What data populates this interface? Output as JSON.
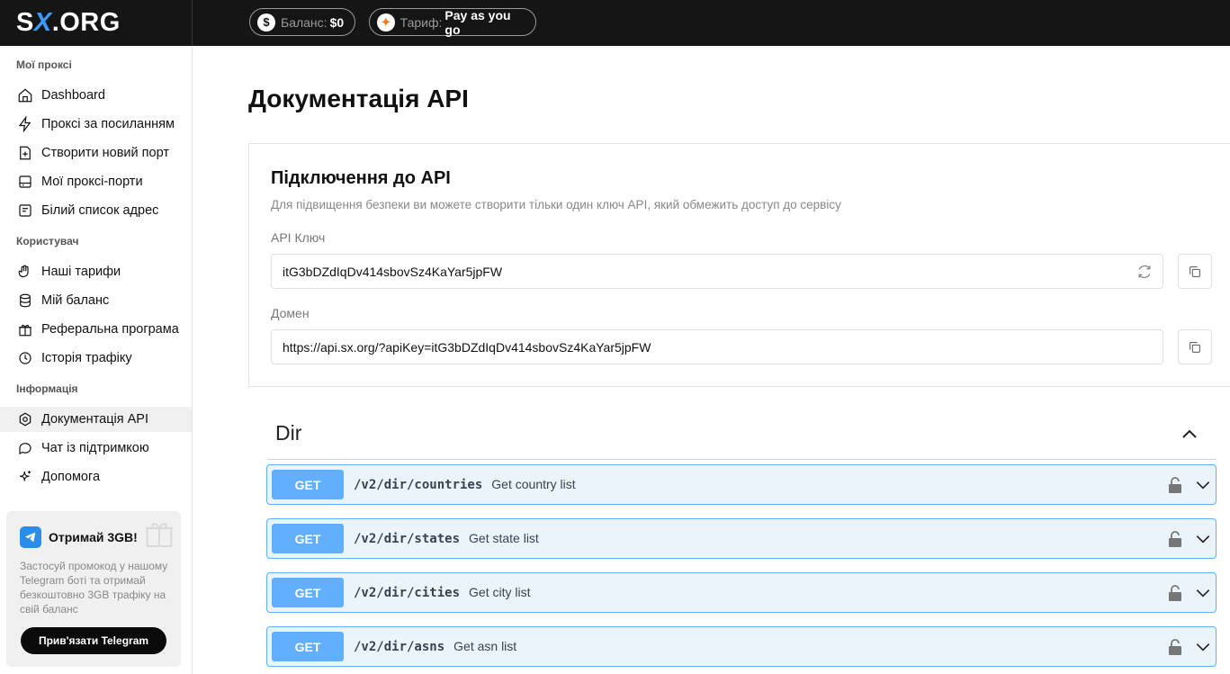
{
  "header": {
    "logo": {
      "left": "S",
      "x": "X",
      "right": ".ORG"
    },
    "balance": {
      "icon": "dollar-icon",
      "label": "Баланс:",
      "value": "$0"
    },
    "tariff": {
      "icon": "tariff-icon",
      "label": "Тариф:",
      "value": "Pay as you go"
    }
  },
  "sidebar": {
    "sections": [
      {
        "title": "Мої проксі",
        "items": [
          {
            "label": "Dashboard",
            "icon": "home-icon"
          },
          {
            "label": "Проксі за посиланням",
            "icon": "bolt-icon"
          },
          {
            "label": "Створити новий порт",
            "icon": "file-plus-icon"
          },
          {
            "label": "Мої проксі-порти",
            "icon": "ports-icon"
          },
          {
            "label": "Білий список адрес",
            "icon": "whitelist-icon"
          }
        ]
      },
      {
        "title": "Користувач",
        "items": [
          {
            "label": "Наші тарифи",
            "icon": "hand-icon"
          },
          {
            "label": "Мій баланс",
            "icon": "database-icon"
          },
          {
            "label": "Реферальна програма",
            "icon": "gift-icon"
          },
          {
            "label": "Історія трафіку",
            "icon": "history-icon"
          }
        ]
      },
      {
        "title": "Інформація",
        "items": [
          {
            "label": "Документація API",
            "icon": "api-docs-icon",
            "active": true
          },
          {
            "label": "Чат із підтримкою",
            "icon": "chat-icon"
          },
          {
            "label": "Допомога",
            "icon": "sparkle-icon"
          }
        ]
      }
    ],
    "promo": {
      "title": "Отримай 3GB!",
      "text": "Застосуй промокод у нашому Telegram боті та отримай безкоштовно 3GB трафіку на свій баланс",
      "button": "Прив'язати Telegram"
    }
  },
  "main": {
    "title": "Документація API",
    "api_card": {
      "title": "Підключення до API",
      "description": "Для підвищення безпеки ви можете створити тільки один ключ API, який обмежить доступ до сервісу",
      "key_label": "API Ключ",
      "key_value": "itG3bDZdIqDv414sbovSz4KaYar5jpFW",
      "domain_label": "Домен",
      "domain_value": "https://api.sx.org/?apiKey=itG3bDZdIqDv414sbovSz4KaYar5jpFW"
    },
    "section": {
      "title": "Dir",
      "operations": [
        {
          "method": "GET",
          "path": "/v2/dir/countries",
          "summary": "Get country list"
        },
        {
          "method": "GET",
          "path": "/v2/dir/states",
          "summary": "Get state list"
        },
        {
          "method": "GET",
          "path": "/v2/dir/cities",
          "summary": "Get city list"
        },
        {
          "method": "GET",
          "path": "/v2/dir/asns",
          "summary": "Get asn list"
        }
      ]
    }
  },
  "colors": {
    "topbar": "#151515",
    "get_method": "#61affe",
    "get_bg": "#ebf3fb",
    "telegram": "#2a8ee8"
  }
}
